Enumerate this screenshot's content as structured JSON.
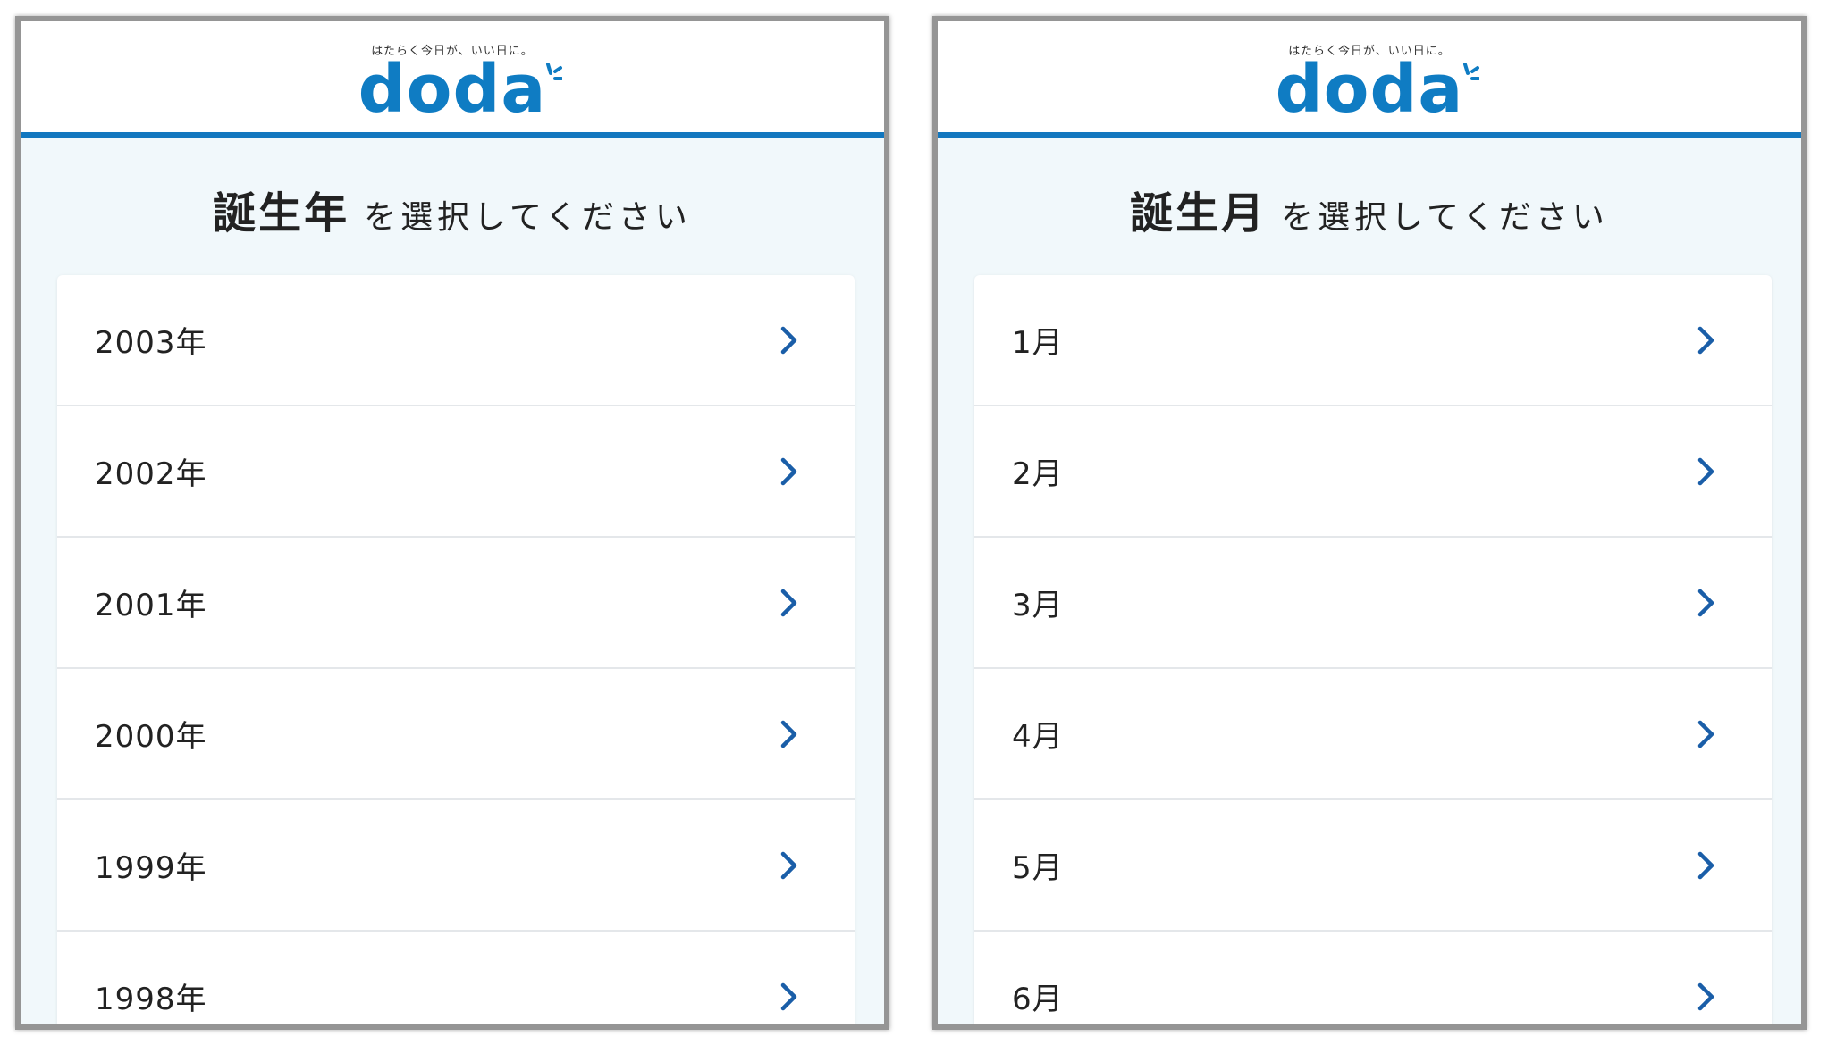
{
  "brand": {
    "tagline": "はたらく今日が、いい日に。",
    "logo_text": "doda",
    "color": "#0f7cc3",
    "header_rule_color": "#1277bf"
  },
  "screens": [
    {
      "heading_strong": "誕生年",
      "heading_rest": "を選択してください",
      "items": [
        "2003年",
        "2002年",
        "2001年",
        "2000年",
        "1999年",
        "1998年"
      ]
    },
    {
      "heading_strong": "誕生月",
      "heading_rest": "を選択してください",
      "items": [
        "1月",
        "2月",
        "3月",
        "4月",
        "5月",
        "6月"
      ]
    }
  ],
  "icons": {
    "chevron": "chevron-right-icon",
    "chevron_color": "#1a5ea8"
  }
}
